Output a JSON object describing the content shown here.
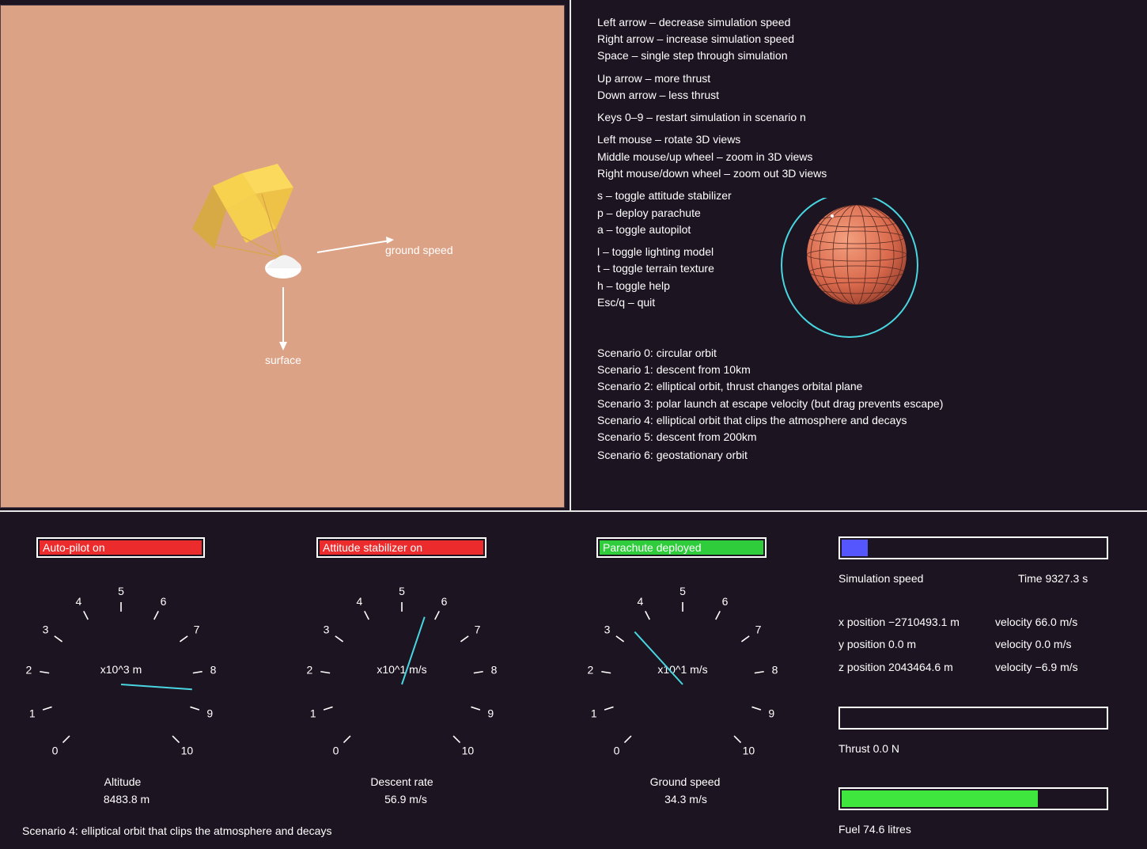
{
  "view3d": {
    "ground_speed_label": "ground speed",
    "surface_label": "surface"
  },
  "help": {
    "lines": [
      "Left arrow – decrease simulation speed",
      "Right arrow – increase simulation speed",
      "Space – single step through simulation",
      "Up arrow – more thrust",
      "Down arrow – less thrust",
      "Keys 0–9 – restart simulation in scenario n",
      "Left mouse – rotate 3D views",
      "Middle mouse/up wheel – zoom in 3D views",
      "Right mouse/down wheel – zoom out 3D views",
      "s – toggle attitude stabilizer",
      "p – deploy parachute",
      "a – toggle autopilot",
      "l – toggle lighting model",
      "t – toggle terrain texture",
      "h – toggle help",
      "Esc/q – quit"
    ],
    "scenarios": [
      "Scenario 0: circular orbit",
      "Scenario 1: descent from 10km",
      "Scenario 2: elliptical orbit, thrust changes orbital plane",
      "Scenario 3: polar launch at escape velocity (but drag prevents escape)",
      "Scenario 4: elliptical orbit that clips the atmosphere and decays",
      "Scenario 5: descent from 200km",
      "Scenario 6: geostationary orbit"
    ]
  },
  "status": {
    "autopilot": {
      "label": "Auto-pilot on",
      "color": "#ec2c2c"
    },
    "stabilizer": {
      "label": "Attitude stabilizer on",
      "color": "#ec2c2c"
    },
    "parachute": {
      "label": "Parachute deployed",
      "color": "#2fcc3c"
    }
  },
  "gauges": [
    {
      "unit_label": "x10^3 m",
      "title": "Altitude",
      "value": "8483.8 m",
      "needle": 8.48
    },
    {
      "unit_label": "x10^1 m/s",
      "title": "Descent rate",
      "value": "56.9 m/s",
      "needle": 5.69
    },
    {
      "unit_label": "x10^1 m/s",
      "title": "Ground speed",
      "value": "34.3 m/s",
      "needle": 3.43
    }
  ],
  "dial_ticks": [
    "0",
    "1",
    "2",
    "3",
    "4",
    "5",
    "6",
    "7",
    "8",
    "9",
    "10"
  ],
  "telemetry": {
    "sim_speed_label": "Simulation speed",
    "sim_speed_fraction": 0.1,
    "time": "Time 9327.3 s",
    "x_position": "x position −2710493.1 m",
    "y_position": "y position 0.0 m",
    "z_position": "z position 2043464.6 m",
    "x_velocity": "velocity 66.0 m/s",
    "y_velocity": "velocity 0.0 m/s",
    "z_velocity": "velocity −6.9 m/s",
    "thrust": "Thrust 0.0 N",
    "thrust_fraction": 0.0,
    "fuel": "Fuel 74.6 litres",
    "fuel_fraction": 0.746
  },
  "footer_scenario": "Scenario 4: elliptical orbit that clips the atmosphere and decays",
  "colors": {
    "background": "#1c1421",
    "terrain": "#dca285",
    "needle": "#48d6e0",
    "orbit": "#48d6e0",
    "planet": "#e07a5a",
    "sim_speed_fill": "#5656ff",
    "fuel_fill": "#3ee63e"
  }
}
